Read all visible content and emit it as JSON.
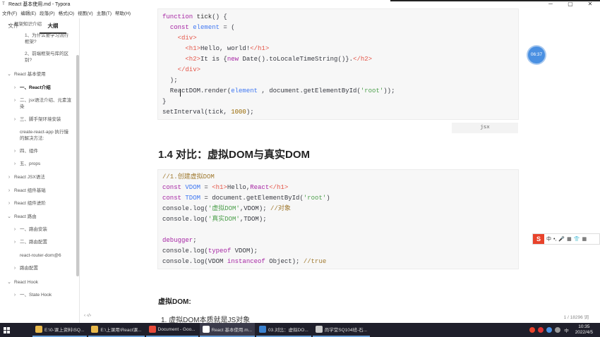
{
  "window": {
    "title": "React 基本使用.md - Typora",
    "app_icon": "T",
    "controls": [
      "─",
      "▢",
      "✕"
    ]
  },
  "menu": [
    "文件(F)",
    "编辑(E)",
    "段落(P)",
    "格式(O)",
    "视图(V)",
    "主题(T)",
    "帮助(H)"
  ],
  "sidebar": {
    "tabs": [
      "文件",
      "大纲"
    ],
    "active_tab": "大纲",
    "items": [
      {
        "chev": "⌄",
        "label": "框架知识介绍",
        "indent": 0
      },
      {
        "chev": "",
        "label": "1、为什么要学习流行框架?",
        "indent": 2
      },
      {
        "chev": "",
        "label": "2、前端框架与库的区别?",
        "indent": 2
      },
      {
        "chev": "⌄",
        "label": "React 基本使用",
        "indent": 0
      },
      {
        "chev": "›",
        "label": "一、React介绍",
        "indent": 1,
        "active": true
      },
      {
        "chev": "›",
        "label": "二、jsx语法介绍、元素渲染",
        "indent": 1
      },
      {
        "chev": "›",
        "label": "三、脚手架环境安装",
        "indent": 1
      },
      {
        "chev": "",
        "label": "create-react-app 执行慢的解决方法:",
        "indent": 1
      },
      {
        "chev": "›",
        "label": "四、组件",
        "indent": 1
      },
      {
        "chev": "›",
        "label": "五、props",
        "indent": 1
      },
      {
        "chev": "›",
        "label": "React JSX语法",
        "indent": 0
      },
      {
        "chev": "›",
        "label": "React 组件基础",
        "indent": 0
      },
      {
        "chev": "›",
        "label": "React 组件进阶",
        "indent": 0
      },
      {
        "chev": "⌄",
        "label": "React 路由",
        "indent": 0
      },
      {
        "chev": "›",
        "label": "一、路由安装",
        "indent": 1
      },
      {
        "chev": "›",
        "label": "二、路由配置",
        "indent": 1
      },
      {
        "chev": "",
        "label": "react-router-dom@6",
        "indent": 1
      },
      {
        "chev": "›",
        "label": "路由配置",
        "indent": 1
      },
      {
        "chev": "⌄",
        "label": "React Hook",
        "indent": 0
      },
      {
        "chev": "›",
        "label": "一、State Hook",
        "indent": 1
      }
    ]
  },
  "editor": {
    "code1_lines": [
      [
        [
          "kw",
          "function "
        ],
        [
          "fn",
          "tick"
        ],
        [
          "plain",
          "() {"
        ]
      ],
      [
        [
          "plain",
          "  "
        ],
        [
          "kw",
          "const "
        ],
        [
          "var",
          "element"
        ],
        [
          "plain",
          " = ("
        ]
      ],
      [
        [
          "plain",
          "    "
        ],
        [
          "tag",
          "<div>"
        ]
      ],
      [
        [
          "plain",
          "      "
        ],
        [
          "tag",
          "<h1>"
        ],
        [
          "plain",
          "Hello, world!"
        ],
        [
          "tag",
          "</h1>"
        ]
      ],
      [
        [
          "plain",
          "      "
        ],
        [
          "tag",
          "<h2>"
        ],
        [
          "plain",
          "It is {"
        ],
        [
          "kw",
          "new "
        ],
        [
          "plain",
          "Date().toLocaleTimeString()}."
        ],
        [
          "tag",
          "</h2>"
        ]
      ],
      [
        [
          "plain",
          "    "
        ],
        [
          "tag",
          "</div>"
        ]
      ],
      [
        [
          "plain",
          "  );"
        ]
      ],
      [
        [
          "plain",
          "  ReactDOM.render("
        ],
        [
          "var",
          "element"
        ],
        [
          "plain",
          " , document.getElementById("
        ],
        [
          "str",
          "'root'"
        ],
        [
          "plain",
          "));"
        ]
      ],
      [
        [
          "plain",
          "}"
        ]
      ],
      [
        [
          "plain",
          "setInterval(tick, "
        ],
        [
          "num",
          "1000"
        ],
        [
          "plain",
          ");"
        ]
      ]
    ],
    "code_lang": "jsx",
    "heading": "1.4 对比：虚拟DOM与真实DOM",
    "code2_lines": [
      [
        [
          "cmt",
          "//1.创建虚拟DOM"
        ]
      ],
      [
        [
          "kw",
          "const "
        ],
        [
          "var",
          "VDOM"
        ],
        [
          "plain",
          " = "
        ],
        [
          "tag",
          "<h1>"
        ],
        [
          "plain",
          "Hello,"
        ],
        [
          "kw",
          "React"
        ],
        [
          "tag",
          "</h1>"
        ]
      ],
      [
        [
          "kw",
          "const "
        ],
        [
          "var",
          "TDOM"
        ],
        [
          "plain",
          " = document.getElementById("
        ],
        [
          "str",
          "'root'"
        ],
        [
          "plain",
          ")"
        ]
      ],
      [
        [
          "plain",
          "console.log("
        ],
        [
          "str",
          "'虚拟DOM'"
        ],
        [
          "plain",
          ",VDOM); "
        ],
        [
          "cmt",
          "//对象"
        ]
      ],
      [
        [
          "plain",
          "console.log("
        ],
        [
          "str",
          "'真实DOM'"
        ],
        [
          "plain",
          ",TDOM);"
        ]
      ],
      [
        [
          "plain",
          ""
        ]
      ],
      [
        [
          "kw",
          "debugger"
        ],
        [
          "plain",
          ";"
        ]
      ],
      [
        [
          "plain",
          "console.log("
        ],
        [
          "kw",
          "typeof "
        ],
        [
          "plain",
          "VDOM);"
        ]
      ],
      [
        [
          "plain",
          "console.log(VDOM "
        ],
        [
          "kw",
          "instanceof "
        ],
        [
          "plain",
          "Object); "
        ],
        [
          "cmt",
          "//true"
        ]
      ]
    ],
    "subheading": "虚拟DOM:",
    "list_item": "1. 虚拟DOM本质就是JS对象"
  },
  "overlay": {
    "timer": "06:37",
    "ime_logo": "S",
    "ime_items": [
      "中",
      "•,",
      "🎤",
      "▦",
      "👕",
      "▦"
    ]
  },
  "status": {
    "left": "‹  ‹/›",
    "word_count": "1 / 18296 词"
  },
  "taskbar": {
    "tasks": [
      {
        "label": "E:\\0-课上资料\\SQ...",
        "color": "#e8b84a"
      },
      {
        "label": "E:\\上课用\\React课...",
        "color": "#e8b84a"
      },
      {
        "label": "Document - Goo...",
        "color": "#e84a3a"
      },
      {
        "label": "React 基本使用.m...",
        "color": "#ffffff",
        "active": true
      },
      {
        "label": "03.对比：虚拟DO...",
        "color": "#3b82d0"
      },
      {
        "label": "尚学堂SQ104班-石...",
        "color": "#cccccc"
      }
    ],
    "time": "10:35",
    "date": "2022/4/5",
    "tray_text": "中"
  }
}
